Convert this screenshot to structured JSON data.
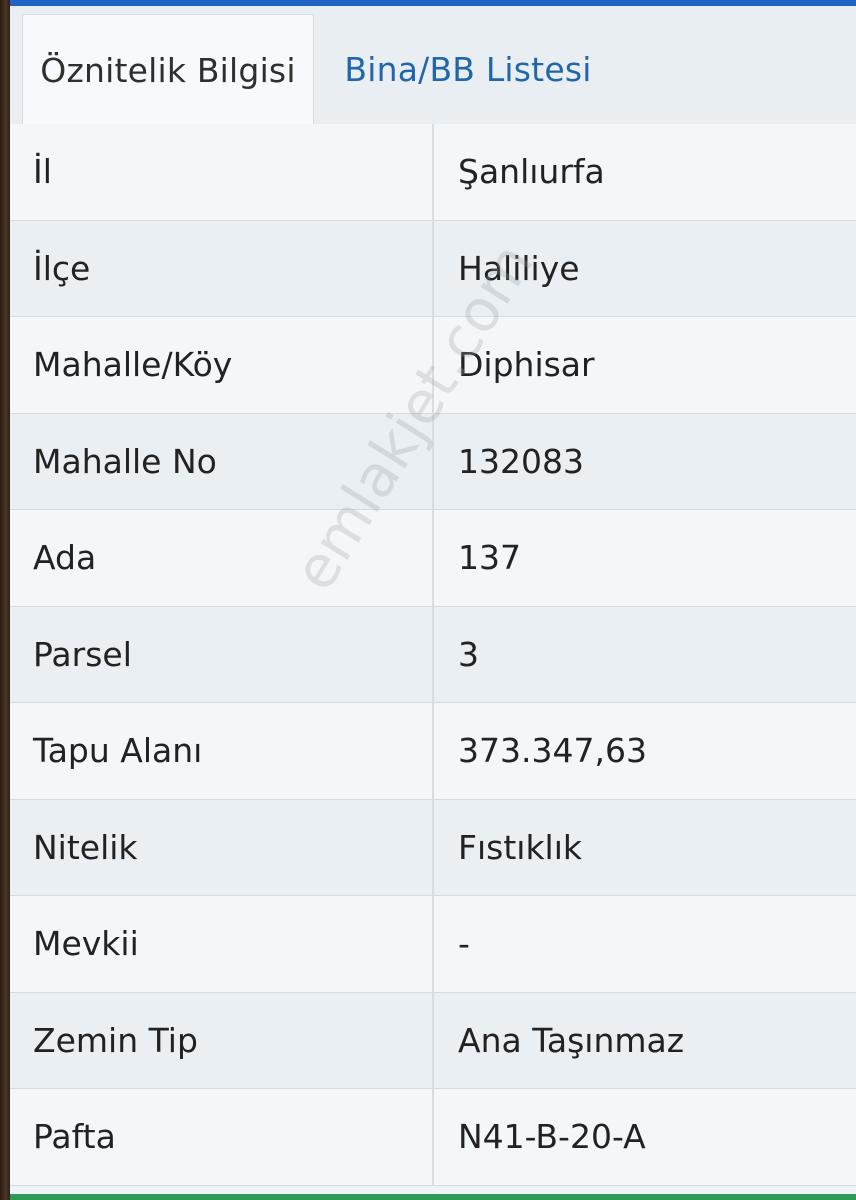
{
  "tabs": [
    {
      "label": "Öznitelik Bilgisi",
      "active": true
    },
    {
      "label": "Bina/BB Listesi",
      "active": false
    }
  ],
  "rows": [
    {
      "key": "İl",
      "value": "Şanlıurfa"
    },
    {
      "key": "İlçe",
      "value": "Haliliye"
    },
    {
      "key": "Mahalle/Köy",
      "value": "Diphisar"
    },
    {
      "key": "Mahalle No",
      "value": "132083"
    },
    {
      "key": "Ada",
      "value": "137"
    },
    {
      "key": "Parsel",
      "value": "3"
    },
    {
      "key": "Tapu Alanı",
      "value": "373.347,63"
    },
    {
      "key": "Nitelik",
      "value": "Fıstıklık"
    },
    {
      "key": "Mevkii",
      "value": "-"
    },
    {
      "key": "Zemin Tip",
      "value": "Ana Taşınmaz"
    },
    {
      "key": "Pafta",
      "value": "N41-B-20-A"
    }
  ],
  "watermark": "emlakjet.com",
  "colors": {
    "accent": "#1f64c4",
    "tab_link": "#2266aa",
    "bottom_bar": "#2f9a55"
  }
}
